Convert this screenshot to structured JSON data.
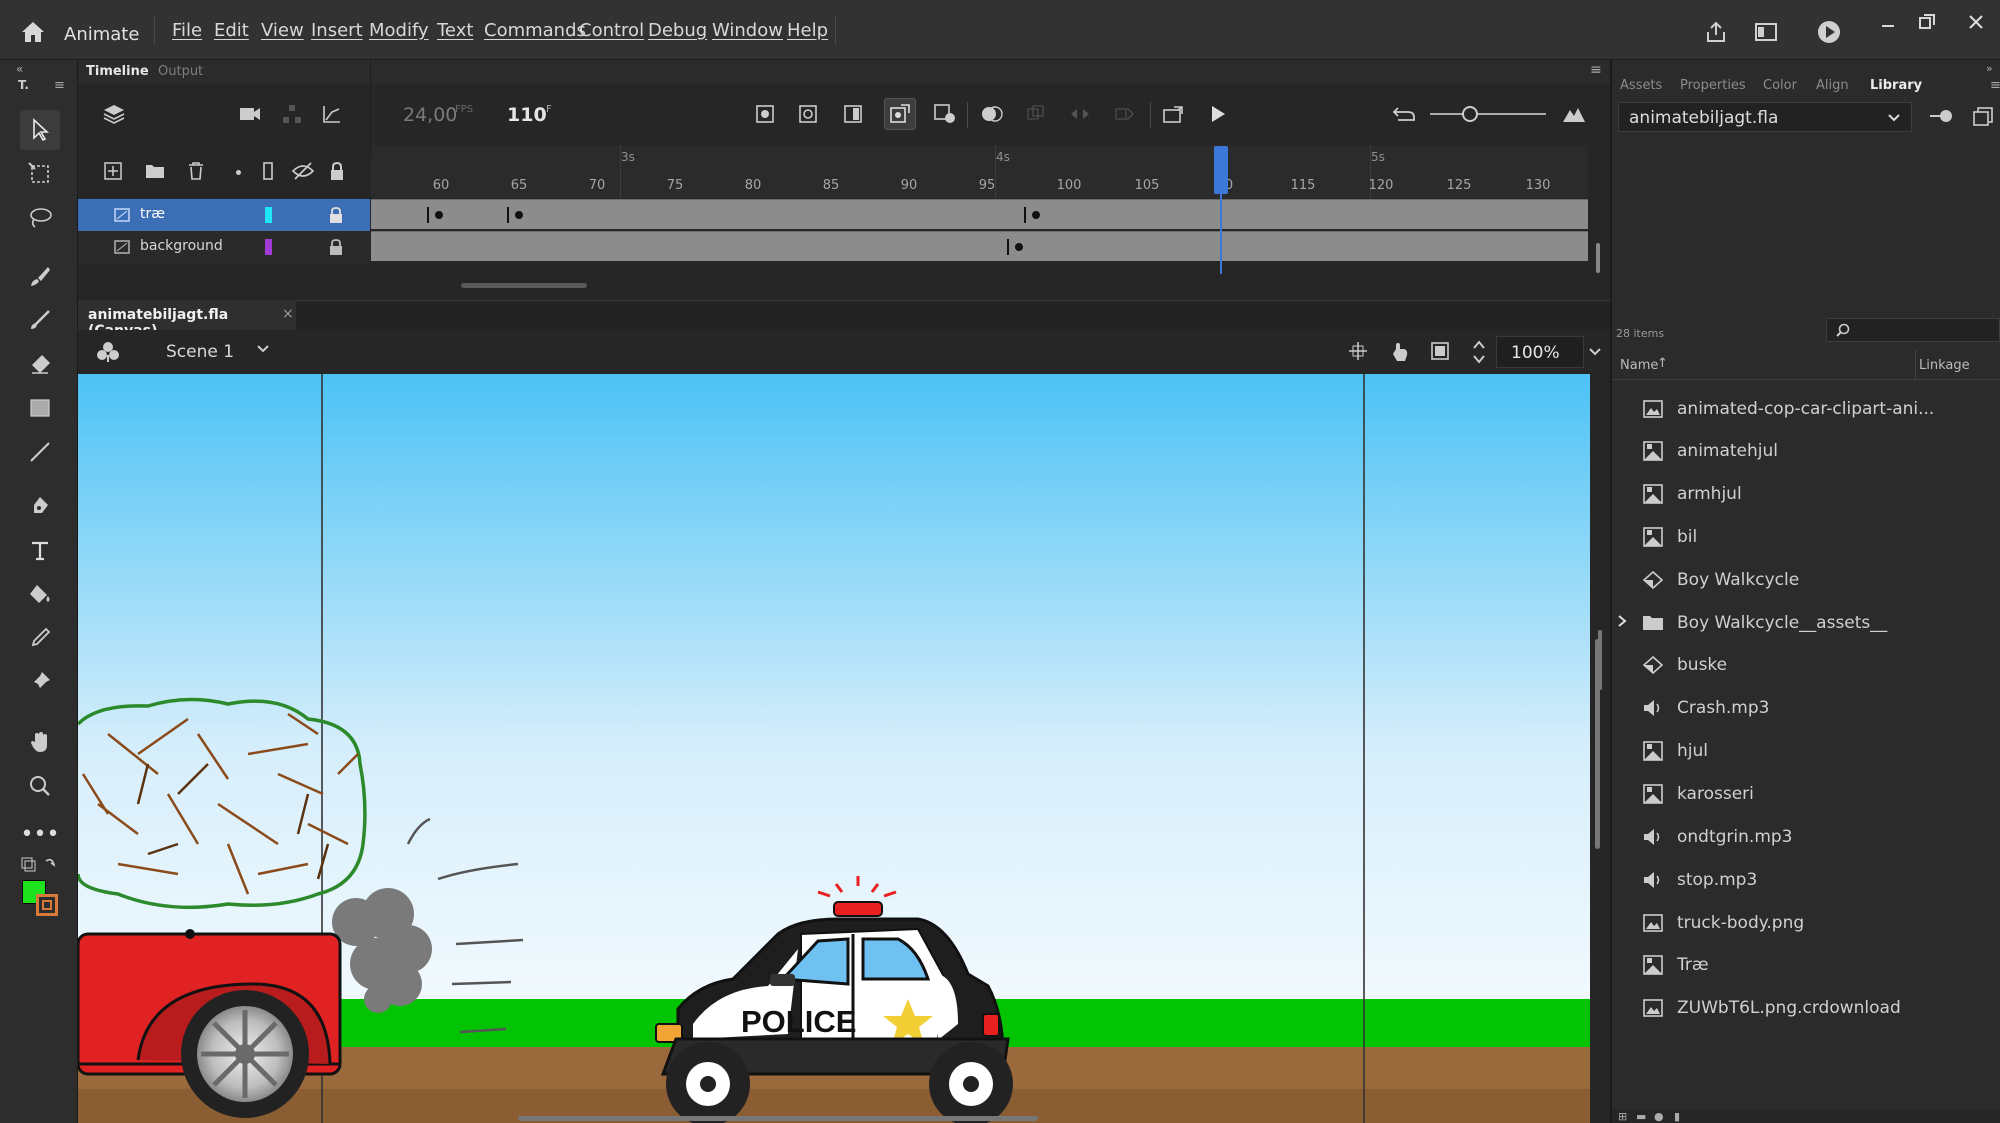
{
  "menubar": {
    "app_name": "Animate",
    "items": [
      "File",
      "Edit",
      "View",
      "Insert",
      "Modify",
      "Text",
      "Commands",
      "Control",
      "Debug",
      "Window",
      "Help"
    ]
  },
  "timeline": {
    "tabs": [
      "Timeline",
      "Output"
    ],
    "fps": "24,00",
    "fps_unit": "FPS",
    "frame": "110",
    "frame_unit": "F",
    "seconds_markers": [
      "3s",
      "4s",
      "5s"
    ],
    "ruler_numbers": [
      "60",
      "65",
      "70",
      "75",
      "80",
      "85",
      "90",
      "95",
      "100",
      "105",
      "0",
      "115",
      "120",
      "125",
      "130"
    ],
    "layers": [
      {
        "name": "træ",
        "color": "#1ee6f7"
      },
      {
        "name": "background",
        "color": "#a23ad4"
      }
    ]
  },
  "document": {
    "tab_label": "animatebiljagt.fla (Canvas)",
    "scene": "Scene 1",
    "zoom": "100%"
  },
  "stage": {
    "police_text": "POLICE"
  },
  "library": {
    "tabs": [
      "Assets",
      "Properties",
      "Color",
      "Align",
      "Library"
    ],
    "active_tab": "Library",
    "file": "animatebiljagt.fla",
    "item_count": "28 items",
    "col_name": "Name",
    "col_linkage": "Linkage",
    "items": [
      {
        "name": "animated-cop-car-clipart-ani...",
        "icon": "bitmap-icon"
      },
      {
        "name": "animatehjul",
        "icon": "movieclip-icon"
      },
      {
        "name": "armhjul",
        "icon": "movieclip-icon"
      },
      {
        "name": "bil",
        "icon": "movieclip-icon"
      },
      {
        "name": "Boy Walkcycle",
        "icon": "graphic-symbol-icon"
      },
      {
        "name": "Boy Walkcycle__assets__",
        "icon": "folder-icon"
      },
      {
        "name": "buske",
        "icon": "graphic-symbol-icon"
      },
      {
        "name": "Crash.mp3",
        "icon": "sound-icon"
      },
      {
        "name": "hjul",
        "icon": "movieclip-icon"
      },
      {
        "name": "karosseri",
        "icon": "movieclip-icon"
      },
      {
        "name": "ondtgrin.mp3",
        "icon": "sound-icon"
      },
      {
        "name": "stop.mp3",
        "icon": "sound-icon"
      },
      {
        "name": "truck-body.png",
        "icon": "bitmap-icon"
      },
      {
        "name": "Træ",
        "icon": "movieclip-icon"
      },
      {
        "name": "ZUWbT6L.png.crdownload",
        "icon": "bitmap-icon"
      }
    ]
  },
  "colors": {
    "accent_blue": "#3b6eb4",
    "stroke_color": "#2f9e2f",
    "fill_color": "#1fe21f"
  }
}
